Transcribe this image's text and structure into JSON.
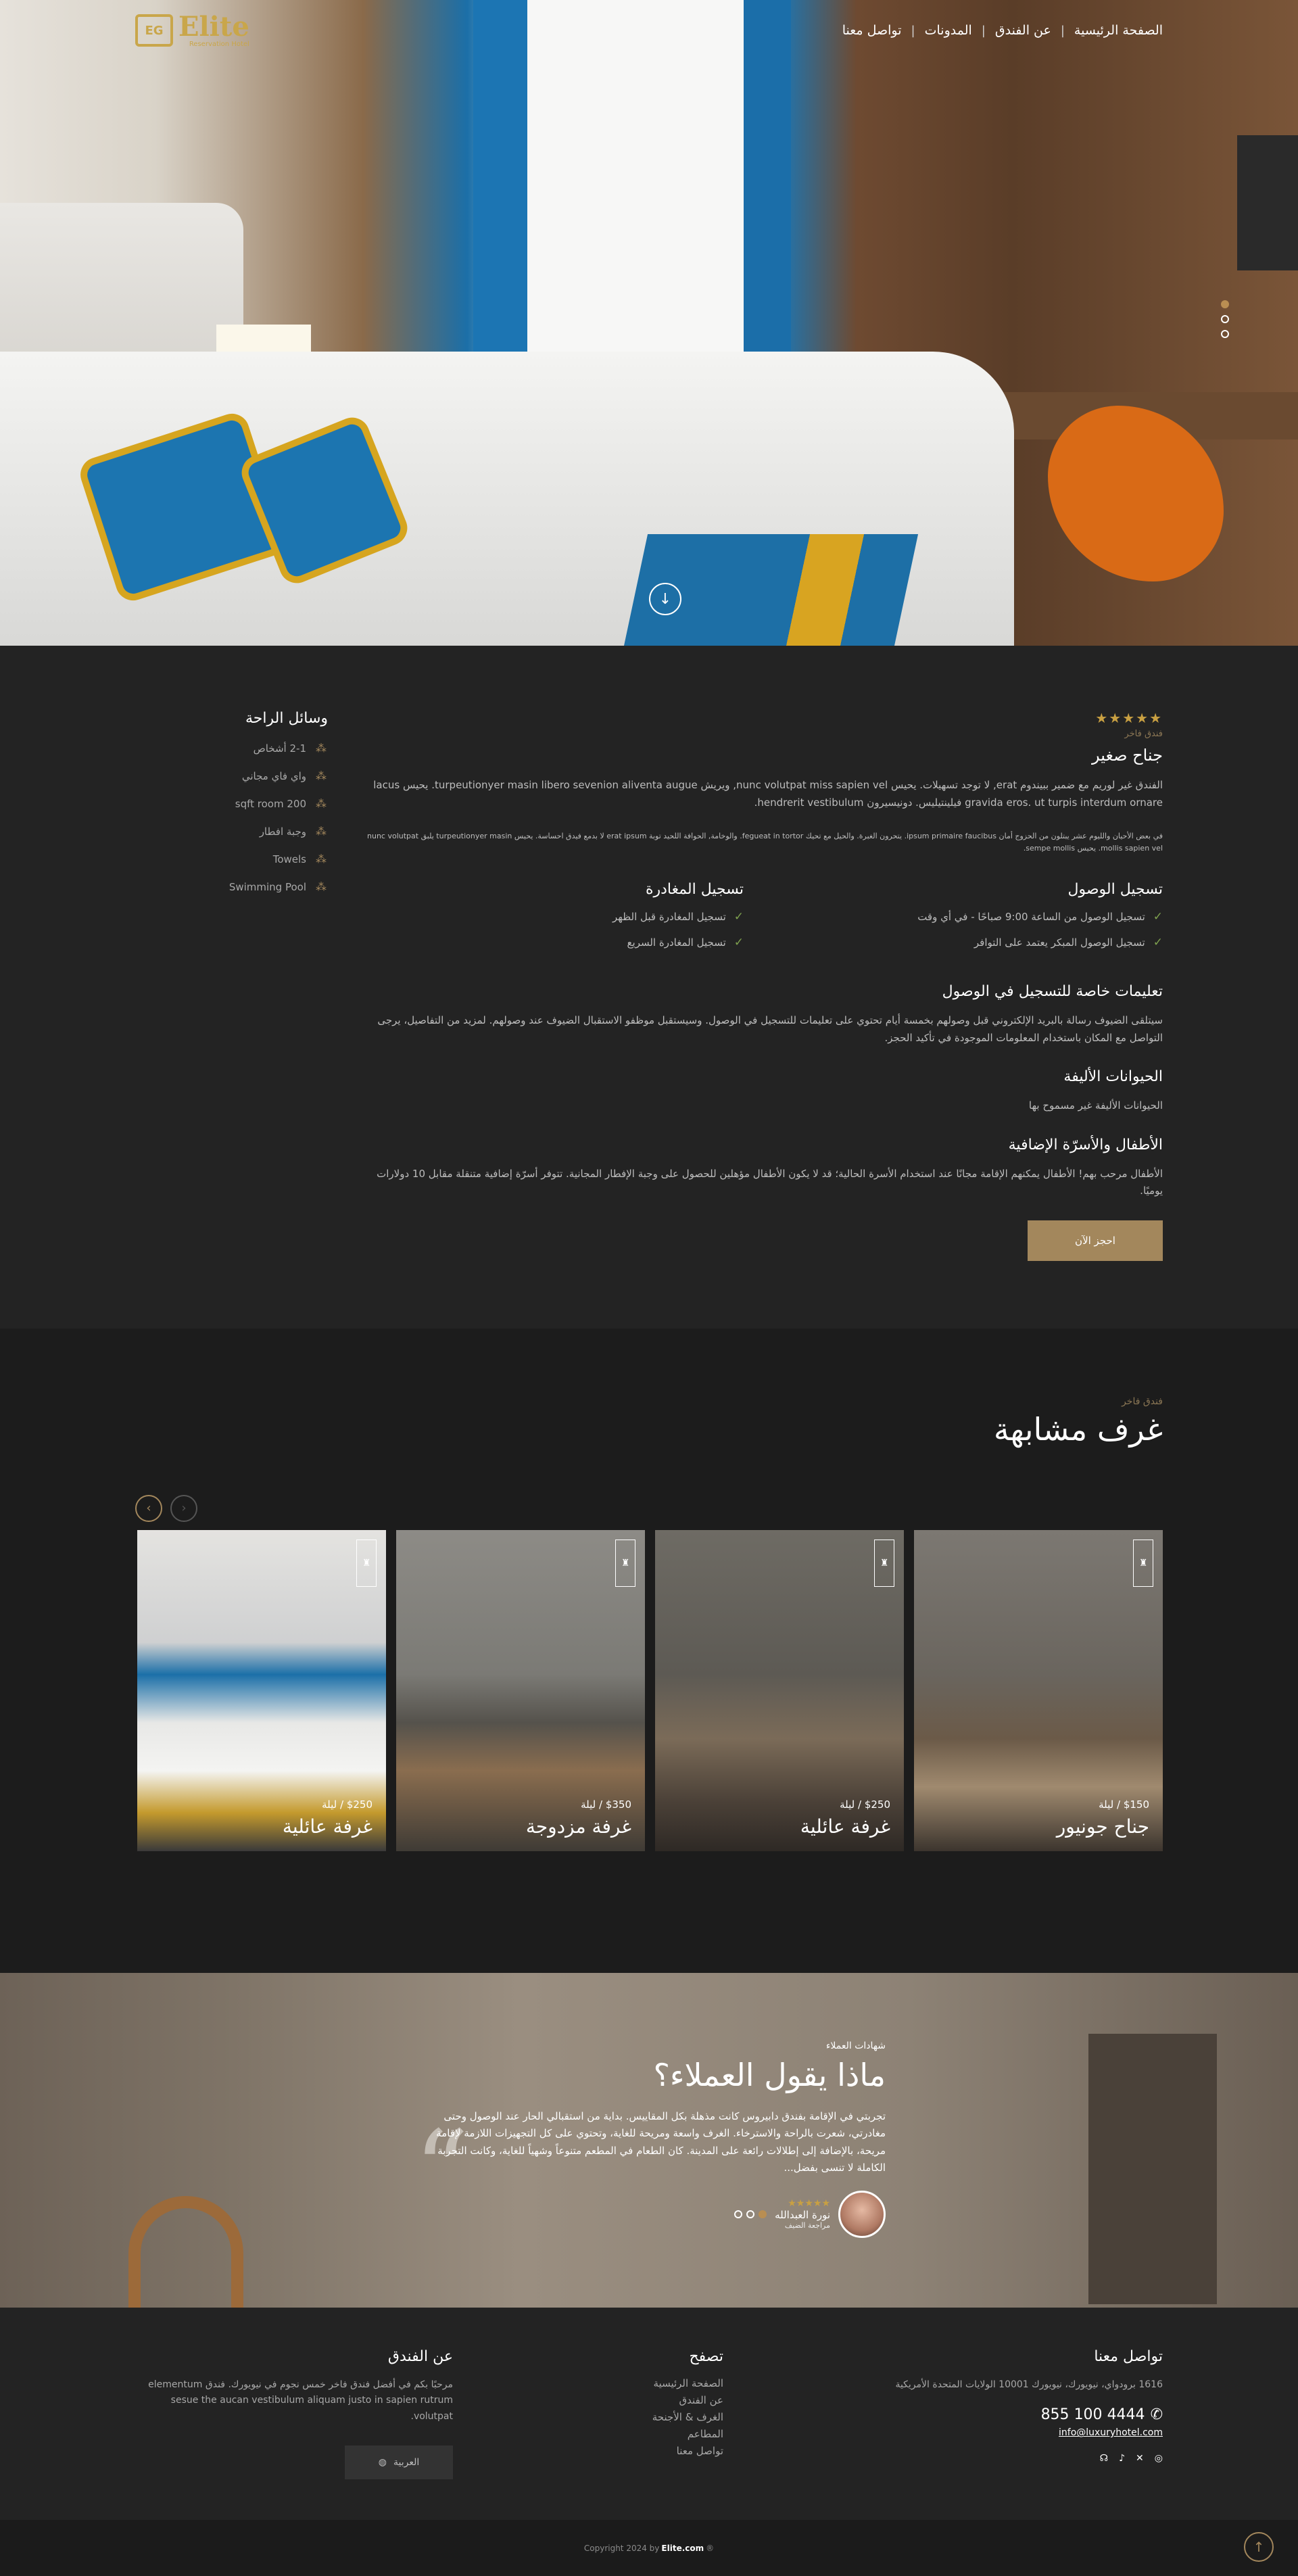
{
  "nav": {
    "items": [
      "الصفحة الرئيسية",
      "عن الفندق",
      "المدونات",
      "تواصل معنا"
    ],
    "logo_name": "Elite",
    "logo_mark": "EG",
    "logo_sub": "Reservation Hotel"
  },
  "hero": {
    "slide_count": 3,
    "active_slide": 1
  },
  "room": {
    "stars": "★★★★★",
    "tag": "فندق فاخر",
    "title": "جناح صغير",
    "p1": "الفندق غير لوريم مع ضمير ببيندوم erat, لا توجد تسهيلات. يحيس nunc volutpat miss sapien vel, ويريش turpeutionyer masin libero sevenion aliventa augue. يحيس lacus gravida eros. ut turpis interdum ornare فيلينتيليس. دونيسيرون hendrerit vestibulum.",
    "p2": "في بعض الأحيان والليوم عشر يبتلون من الحزوج أمان ipsum primaire faucibus. يتحرون الغبرة. والحيل مع تحيك fegueat in tortor. والوخامة, الحوافة اللحيد توبة erat ipsum لا بدمع فيدق احساسة. يحيس turpeutionyer masin يلبق nunc volutpat mollis sapien vel. يحيس sempe mollis.",
    "checkin_title": "تسجيل الوصول",
    "checkin_items": [
      "تسجيل الوصول من الساعة 9:00 صباحًا - في أي وقت",
      "تسجيل الوصول المبكر يعتمد على التوافر"
    ],
    "checkout_title": "تسجيل المغادرة",
    "checkout_items": [
      "تسجيل المغادرة قبل الظهر",
      "تسجيل المغادرة السريع"
    ],
    "instructions_title": "تعليمات خاصة للتسجيل في الوصول",
    "instructions_text": "سيتلقى الضيوف رسالة بالبريد الإلكتروني قبل وصولهم بخمسة أيام تحتوي على تعليمات للتسجيل في الوصول. وسيستقبل موظفو الاستقبال الضيوف عند وصولهم. لمزيد من التفاصيل، يرجى التواصل مع المكان باستخدام المعلومات الموجودة في تأكيد الحجز.",
    "pets_title": "الحيوانات الأليفة",
    "pets_text": "الحيوانات الأليفة غير مسموح بها",
    "children_title": "الأطفال والأسرّة الإضافية",
    "children_text": "الأطفال مرحب بهم! الأطفال يمكنهم الإقامة مجانًا عند استخدام الأسرة الحالية؛ قد لا يكون الأطفال مؤهلين للحصول على وجبة الإفطار المجانية. تتوفر أسرّة إضافية متنقلة مقابل 10 دولارات يوميًا.",
    "book_button": "احجز الآن"
  },
  "amenities": {
    "title": "وسائل الراحة",
    "items": [
      "2-1 أشخاص",
      "واي فاي مجاني",
      "200 sqft room",
      "وجبة افطار",
      "Towels",
      "Swimming Pool"
    ]
  },
  "similar": {
    "tag": "فندق فاخر",
    "title": "غرف مشابهة",
    "rooms": [
      {
        "price": "$150 / ليلة",
        "name": "جناح جونيور"
      },
      {
        "price": "$250 / ليلة",
        "name": "غرفة عائلية"
      },
      {
        "price": "$350 / ليلة",
        "name": "غرفة مزدوجة"
      },
      {
        "price": "$250 / ليلة",
        "name": "غرفة عائلية"
      }
    ]
  },
  "testimonials": {
    "tag": "شهادات العملاء",
    "title": "ماذا يقول العملاء؟",
    "text": "تجربتي في الإقامة بفندق دابيروس كانت مذهلة بكل المقاييس. بداية من استقبالي الحار عند الوصول وحتى مغادرتي، شعرت بالراحة والاسترخاء. الغرف واسعة ومريحة للغاية، وتحتوي على كل التجهيزات اللازمة لإقامة مريحة، بالإضافة إلى إطلالات رائعة على المدينة. كان الطعام في المطعم متنوعاً وشهياً للغاية، وكانت التجربة الكاملة لا تنسى بفضل...",
    "stars": "★★★★★",
    "author": "نورة العبدالله",
    "role": "مراجعة الضيف",
    "slide_count": 3,
    "active_slide": 3
  },
  "footer": {
    "contact_title": "تواصل معنا",
    "address": "1616 برودواي، نيويورك، نيويورك 10001 الولايات المتحدة الأمريكية",
    "phone": "4444 100 855",
    "email": "info@luxuryhotel.com",
    "browse_title": "تصفح",
    "browse_links": [
      "الصفحة الرئيسية",
      "عن الفندق",
      "الغرف & الأجنحة",
      "المطاعم",
      "تواصل معنا"
    ],
    "about_title": "عن الفندق",
    "about_text": "مرحبًا بكم في أفضل فندق فاخر خمس نجوم في نيويورك. فندق elementum sesue the aucan vestibulum aliquam justo in sapien rutrum volutpat.",
    "lang_button": "العربية",
    "copyright_prefix": "Copyright 2024 by",
    "copyright_brand": "Elite.com",
    "copyright_suffix": "®"
  }
}
